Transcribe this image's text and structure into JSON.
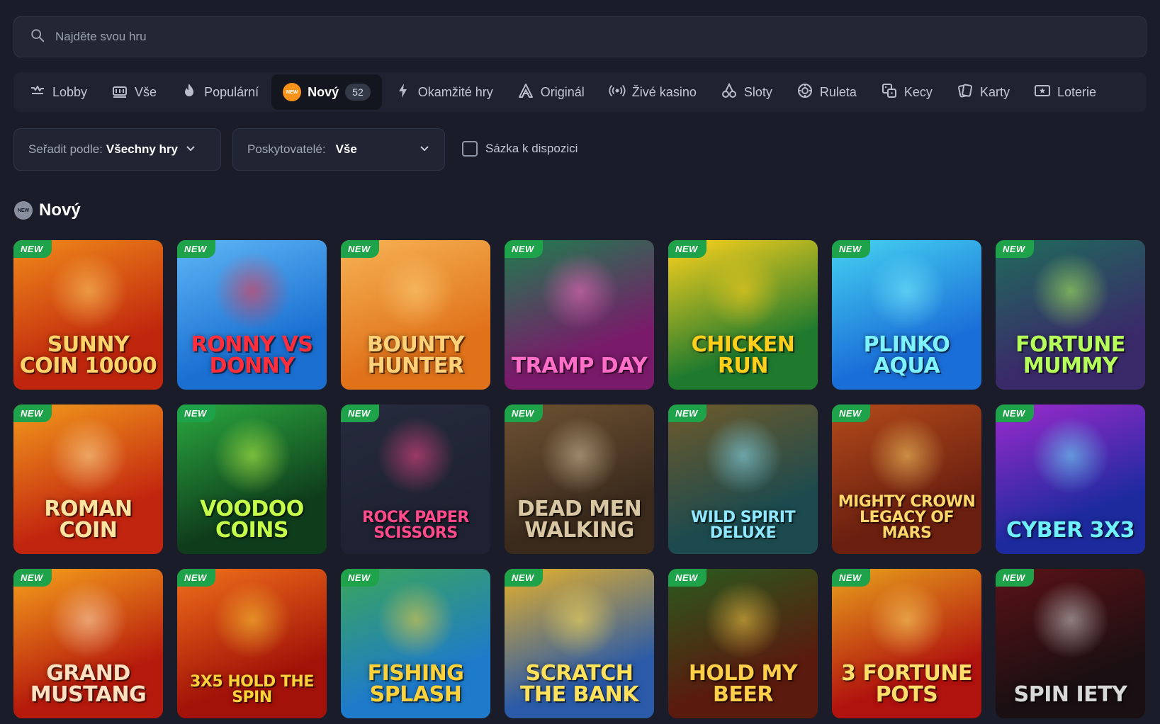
{
  "search": {
    "placeholder": "Najděte svou hru"
  },
  "tabs": [
    {
      "label": "Lobby",
      "icon": "lobby-icon",
      "active": false
    },
    {
      "label": "Vše",
      "icon": "all-games-icon",
      "active": false
    },
    {
      "label": "Populární",
      "icon": "flame-icon",
      "active": false
    },
    {
      "label": "Nový",
      "icon": "new-badge-icon",
      "active": true,
      "count": "52"
    },
    {
      "label": "Okamžité hry",
      "icon": "lightning-icon",
      "active": false
    },
    {
      "label": "Originál",
      "icon": "original-icon",
      "active": false
    },
    {
      "label": "Živé kasino",
      "icon": "live-broadcast-icon",
      "active": false
    },
    {
      "label": "Sloty",
      "icon": "cherries-icon",
      "active": false
    },
    {
      "label": "Ruleta",
      "icon": "roulette-icon",
      "active": false
    },
    {
      "label": "Kecy",
      "icon": "dice-icon",
      "active": false
    },
    {
      "label": "Karty",
      "icon": "cards-icon",
      "active": false
    },
    {
      "label": "Loterie",
      "icon": "lottery-ticket-icon",
      "active": false
    }
  ],
  "filters": {
    "sort_label": "Seřadit podle:",
    "sort_value": "Všechny hry",
    "providers_label": "Poskytovatelé:",
    "providers_value": "Vše",
    "bet_label": "Sázka k dispozici"
  },
  "section": {
    "title": "Nový"
  },
  "badge_text": "NEW",
  "games": [
    {
      "title": "Sunny Coin 10000",
      "bg": "#c0260d",
      "bg2": "#f08a1a",
      "fg": "#ffd36a"
    },
    {
      "title": "Ronny vs Donny",
      "bg": "#1a6fd1",
      "bg2": "#5fb6f5",
      "fg": "#ff2e3a"
    },
    {
      "title": "Bounty Hunter",
      "bg": "#e0721a",
      "bg2": "#f6b354",
      "fg": "#ffd27a"
    },
    {
      "title": "Tramp Day",
      "bg": "#7a1a6a",
      "bg2": "#1e7d4e",
      "fg": "#ff6ec7"
    },
    {
      "title": "Chicken Run",
      "bg": "#1f7a2e",
      "bg2": "#ffd21c",
      "fg": "#ffcf1c"
    },
    {
      "title": "Plinko Aqua",
      "bg": "#1a6ed8",
      "bg2": "#45d2f0",
      "fg": "#7ef3ff"
    },
    {
      "title": "Fortune Mummy",
      "bg": "#3a2a6a",
      "bg2": "#1f6b5a",
      "fg": "#b6ff5a"
    },
    {
      "title": "Roman Coin",
      "bg": "#c2250f",
      "bg2": "#f29a1c",
      "fg": "#ffe3a0"
    },
    {
      "title": "Voodoo Coins",
      "bg": "#0f3d1c",
      "bg2": "#2aa83e",
      "fg": "#c6ff4a"
    },
    {
      "title": "Rock Paper Scissors",
      "bg": "#1e2232",
      "bg2": "#262b3d",
      "fg": "#ff4a8c"
    },
    {
      "title": "Dead Men Walking",
      "bg": "#3a2a1c",
      "bg2": "#6e5232",
      "fg": "#d8c7a2"
    },
    {
      "title": "Wild Spirit Deluxe",
      "bg": "#1c4a4e",
      "bg2": "#6e5a2a",
      "fg": "#8fe8ff"
    },
    {
      "title": "Mighty Crown Legacy of Mars",
      "bg": "#6a1f10",
      "bg2": "#b24a1a",
      "fg": "#ffd66a"
    },
    {
      "title": "Cyber 3x3",
      "bg": "#1c2a9e",
      "bg2": "#9d2acc",
      "fg": "#6ef0ff"
    },
    {
      "title": "Grand Mustang",
      "bg": "#b61a0c",
      "bg2": "#f5a01c",
      "fg": "#ffe0c0"
    },
    {
      "title": "3x5 Hold the Spin",
      "bg": "#a21208",
      "bg2": "#f0701a",
      "fg": "#ffd23a"
    },
    {
      "title": "Fishing Splash",
      "bg": "#1e7acb",
      "bg2": "#3aa65a",
      "fg": "#ffd23a"
    },
    {
      "title": "Scratch the Bank",
      "bg": "#2a5aa8",
      "bg2": "#e6b02a",
      "fg": "#ffe25a"
    },
    {
      "title": "Hold my Beer",
      "bg": "#5a1a0e",
      "bg2": "#2a5a1e",
      "fg": "#ffcf4a"
    },
    {
      "title": "3 Fortune Pots",
      "bg": "#b0120e",
      "bg2": "#e8a01c",
      "fg": "#ffdf6a"
    },
    {
      "title": "Spin Iety",
      "bg": "#1a0f12",
      "bg2": "#5a1216",
      "fg": "#d8d8d8"
    }
  ]
}
